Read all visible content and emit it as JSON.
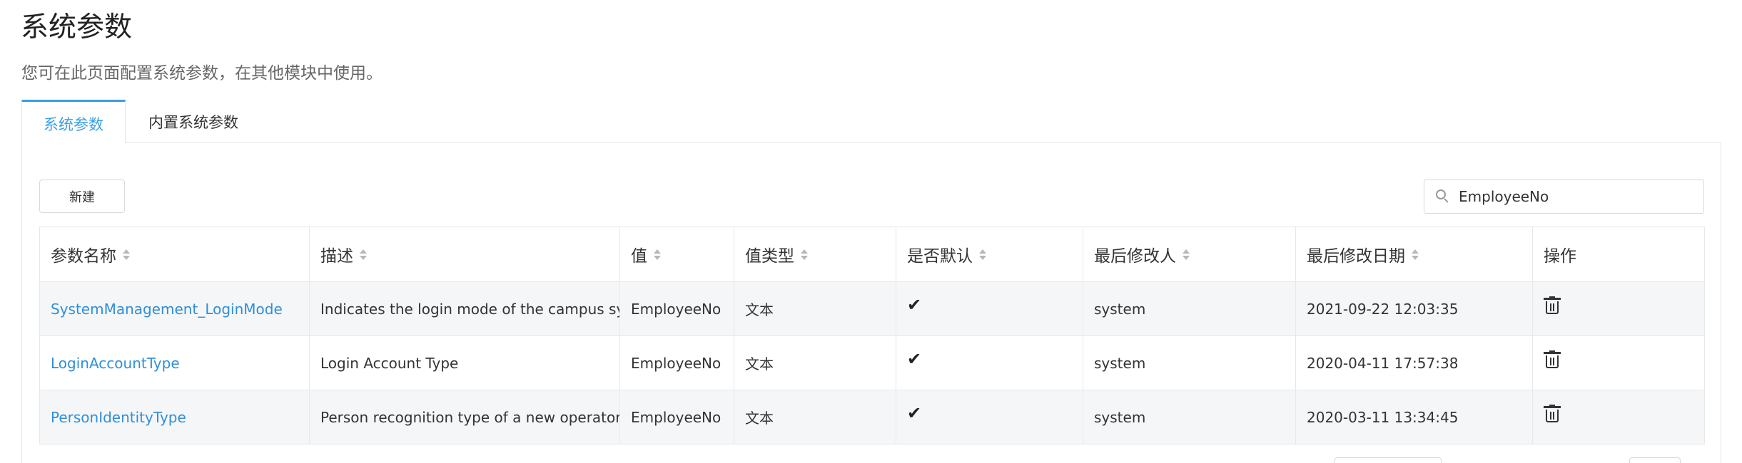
{
  "page": {
    "title": "系统参数",
    "description": "您可在此页面配置系统参数，在其他模块中使用。"
  },
  "tabs": [
    {
      "label": "系统参数",
      "active": true
    },
    {
      "label": "内置系统参数",
      "active": false
    }
  ],
  "toolbar": {
    "new_label": "新建",
    "search_value": "EmployeeNo"
  },
  "table": {
    "columns": [
      "参数名称",
      "描述",
      "值",
      "值类型",
      "是否默认",
      "最后修改人",
      "最后修改日期",
      "操作"
    ],
    "rows": [
      {
        "name": "SystemManagement_LoginMode",
        "description": "Indicates the login mode of the campus system",
        "value": "EmployeeNo",
        "value_type": "文本",
        "is_default": "✔",
        "modified_by": "system",
        "modified_date": "2021-09-22 12:03:35",
        "action_icon": "trash-icon"
      },
      {
        "name": "LoginAccountType",
        "description": "Login Account Type",
        "value": "EmployeeNo",
        "value_type": "文本",
        "is_default": "✔",
        "modified_by": "system",
        "modified_date": "2020-04-11 17:57:38",
        "action_icon": "trash-icon"
      },
      {
        "name": "PersonIdentityType",
        "description": "Person recognition type of a new operator",
        "value": "EmployeeNo",
        "value_type": "文本",
        "is_default": "✔",
        "modified_by": "system",
        "modified_date": "2020-03-11 13:34:45",
        "action_icon": "trash-icon"
      }
    ]
  },
  "colors": {
    "accent": "#3a9ee4",
    "link": "#2f8fd9",
    "stripe": "#f5f6f8",
    "border": "#e8e8e8"
  }
}
